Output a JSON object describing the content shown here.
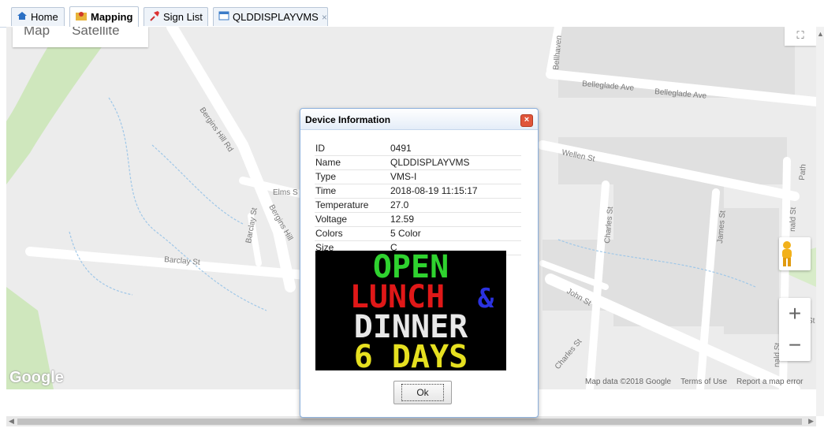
{
  "tabs": [
    {
      "label": "Home",
      "icon": "home-icon",
      "active": false
    },
    {
      "label": "Mapping",
      "icon": "map-icon",
      "active": true
    },
    {
      "label": "Sign List",
      "icon": "pin-icon",
      "active": false
    },
    {
      "label": "QLDDISPLAYVMS",
      "icon": "window-icon",
      "active": false,
      "closable": true
    }
  ],
  "map": {
    "type_buttons": [
      "Map",
      "Satellite"
    ],
    "streets": [
      "Bergins Hill Rd",
      "Barclay St",
      "Barclay St",
      "Elms S",
      "Bergins Hill",
      "Bellhaven",
      "Belleglade Ave",
      "Belleglade Ave",
      "Wellen St",
      "Charles St",
      "James St",
      "John St",
      "Charles St",
      "Path",
      "nald St",
      "nald St",
      "St"
    ],
    "logo": "Google",
    "attribution": [
      "Map data ©2018 Google",
      "Terms of Use",
      "Report a map error"
    ],
    "zoom_in": "+",
    "zoom_out": "−",
    "fullscreen": "⛶"
  },
  "dialog": {
    "title": "Device Information",
    "close": "×",
    "fields": [
      {
        "key": "ID",
        "value": "0491"
      },
      {
        "key": "Name",
        "value": "QLDDISPLAYVMS"
      },
      {
        "key": "Type",
        "value": "VMS-I"
      },
      {
        "key": "Time",
        "value": "2018-08-19 11:15:17"
      },
      {
        "key": "Temperature",
        "value": "27.0"
      },
      {
        "key": "Voltage",
        "value": "12.59"
      },
      {
        "key": "Colors",
        "value": "5 Color"
      },
      {
        "key": "Size",
        "value": "C"
      }
    ],
    "sign_lines": [
      {
        "text": "OPEN",
        "color": "#2fd22f"
      },
      {
        "text": "LUNCH",
        "color": "#e01818",
        "suffix": "&",
        "suffix_color": "#2b32e0"
      },
      {
        "text": "DINNER",
        "color": "#e8e8e8"
      },
      {
        "text": "6 DAYS",
        "color": "#e6e020"
      }
    ],
    "ok_label": "Ok"
  },
  "colors": {
    "accent": "#8cb0dc",
    "map_bg": "#ececec",
    "road": "#ffffff",
    "park": "#c9e6b5"
  }
}
